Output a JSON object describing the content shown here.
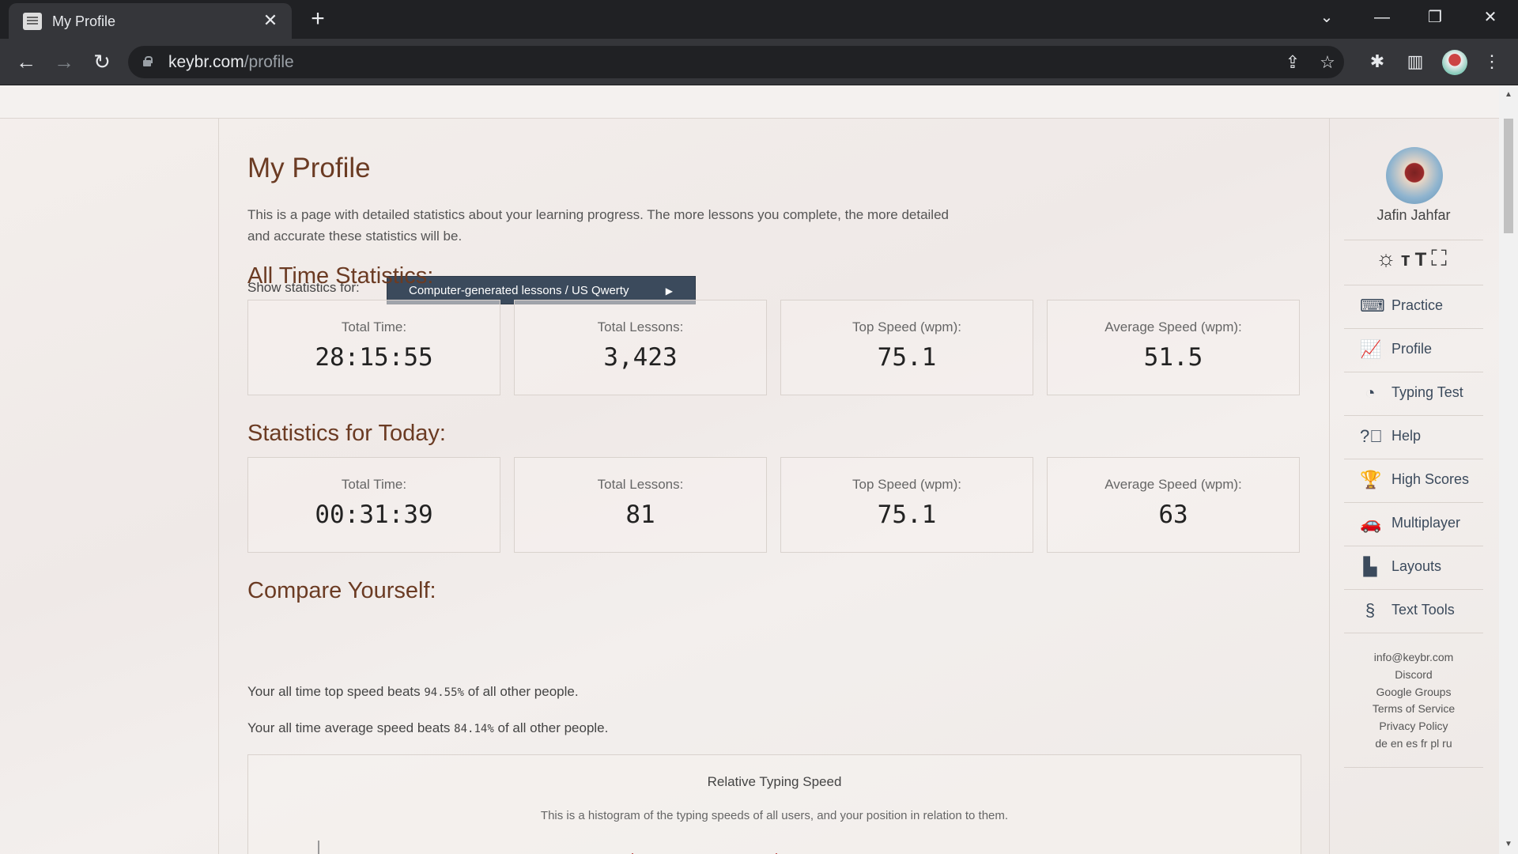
{
  "browser": {
    "tab_title": "My Profile",
    "tab_close": "✕",
    "new_tab": "+",
    "url_host": "keybr.com",
    "url_path": "/profile"
  },
  "page": {
    "title": "My Profile",
    "intro": "This is a page with detailed statistics about your learning progress. The more lessons you complete, the more detailed and accurate these statistics will be.",
    "show_label": "Show statistics for:",
    "dropdown_value": "Computer-generated lessons / US Qwerty",
    "all_time": {
      "heading": "All Time Statistics:",
      "stats": [
        {
          "label": "Total Time:",
          "value": "28:15:55"
        },
        {
          "label": "Total Lessons:",
          "value": "3,423"
        },
        {
          "label": "Top Speed (wpm):",
          "value": "75.1"
        },
        {
          "label": "Average Speed (wpm):",
          "value": "51.5"
        }
      ]
    },
    "today": {
      "heading": "Statistics for Today:",
      "stats": [
        {
          "label": "Total Time:",
          "value": "00:31:39"
        },
        {
          "label": "Total Lessons:",
          "value": "81"
        },
        {
          "label": "Top Speed (wpm):",
          "value": "75.1"
        },
        {
          "label": "Average Speed (wpm):",
          "value": "63"
        }
      ]
    },
    "compare": {
      "heading": "Compare Yourself:",
      "top_prefix": "Your all time top speed beats",
      "top_pct": "94.55%",
      "top_suffix": "of all other people.",
      "avg_prefix": "Your all time average speed beats",
      "avg_pct": "84.14%",
      "avg_suffix": "of all other people."
    },
    "histogram": {
      "title": "Relative Typing Speed",
      "subtitle": "This is a histogram of the typing speeds of all users, and your position in relation to them."
    }
  },
  "sidebar": {
    "user_name": "Jafin Jahfar",
    "nav": [
      {
        "label": "Practice",
        "icon": "keyboard-icon"
      },
      {
        "label": "Profile",
        "icon": "chart-icon"
      },
      {
        "label": "Typing Test",
        "icon": "speedometer-icon"
      },
      {
        "label": "Help",
        "icon": "help-icon"
      },
      {
        "label": "High Scores",
        "icon": "trophy-icon"
      },
      {
        "label": "Multiplayer",
        "icon": "car-icon"
      },
      {
        "label": "Layouts",
        "icon": "layouts-icon"
      },
      {
        "label": "Text Tools",
        "icon": "section-icon"
      }
    ],
    "footer": {
      "email": "info@keybr.com",
      "discord": "Discord",
      "google_groups": "Google Groups",
      "terms": "Terms of Service",
      "privacy": "Privacy Policy",
      "languages": "de en es fr pl ru"
    }
  }
}
